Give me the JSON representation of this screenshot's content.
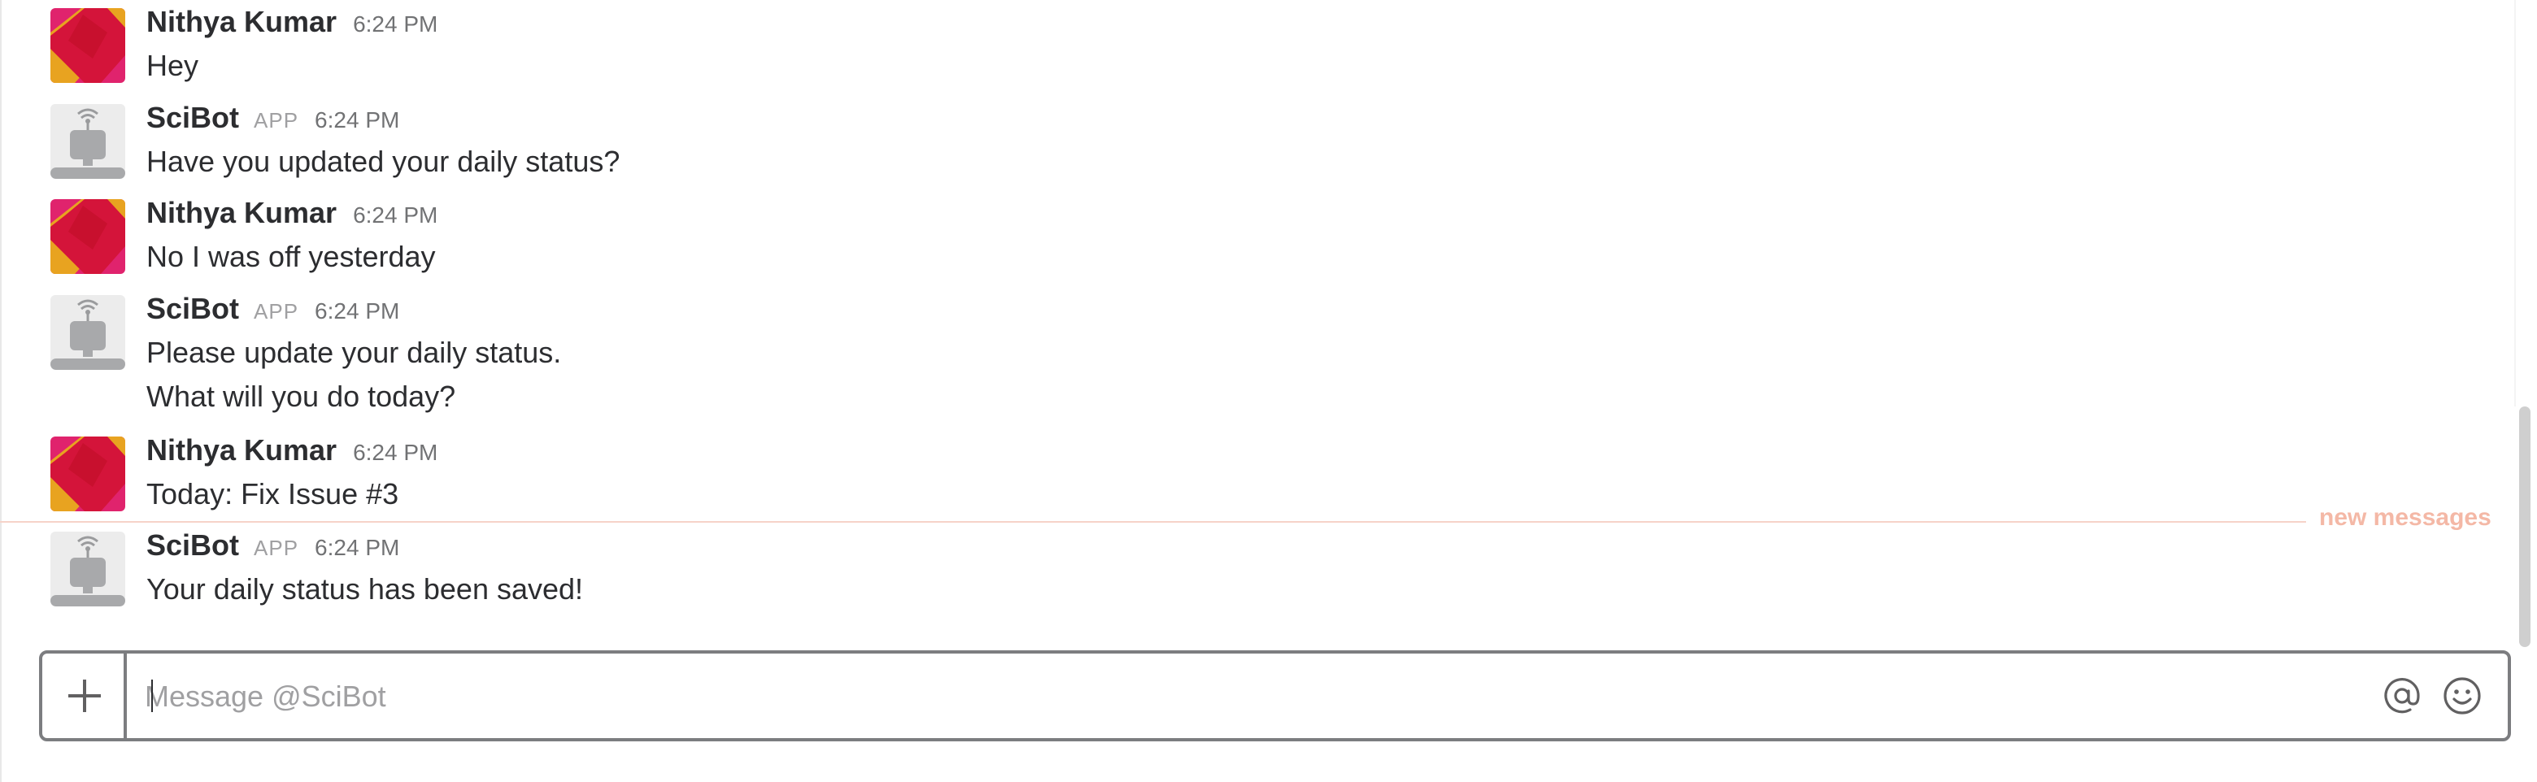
{
  "messages": [
    {
      "sender": "Nithya Kumar",
      "time": "6:24 PM",
      "lines": [
        "Hey"
      ],
      "avatar": "nithya-avatar"
    },
    {
      "sender": "SciBot",
      "badge": "APP",
      "time": "6:24 PM",
      "lines": [
        "Have you updated your daily status?"
      ],
      "avatar": "robot-avatar"
    },
    {
      "sender": "Nithya Kumar",
      "time": "6:24 PM",
      "lines": [
        "No I was off yesterday"
      ],
      "avatar": "nithya-avatar"
    },
    {
      "sender": "SciBot",
      "badge": "APP",
      "time": "6:24 PM",
      "lines": [
        "Please update your daily status.",
        "What will you do today?"
      ],
      "avatar": "robot-avatar"
    },
    {
      "sender": "Nithya Kumar",
      "time": "6:24 PM",
      "lines": [
        "Today: Fix Issue #3"
      ],
      "avatar": "nithya-avatar"
    },
    {
      "sender": "SciBot",
      "badge": "APP",
      "time": "6:24 PM",
      "lines": [
        "Your daily status has been saved!"
      ],
      "avatar": "robot-avatar"
    }
  ],
  "divider": {
    "label": "new messages",
    "color": "#f4b8a6"
  },
  "composer": {
    "placeholder": "Message @SciBot",
    "value": "",
    "plus_icon": "plus-icon",
    "mention_icon": "at-sign-icon",
    "emoji_icon": "smiley-icon"
  },
  "colors": {
    "text": "#2c2d30",
    "muted": "#717274",
    "avatar_red": "#cc1f3f",
    "avatar_yellow": "#e8a320",
    "avatar_pink": "#e0236d",
    "robot_gray": "#a8a9ab"
  }
}
